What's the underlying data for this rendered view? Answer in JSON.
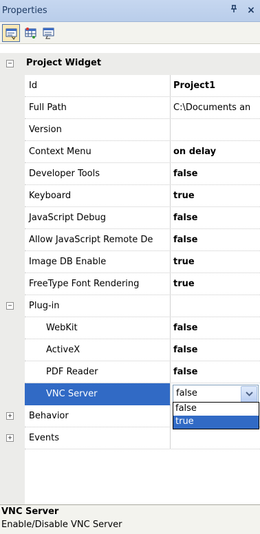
{
  "panel": {
    "title": "Properties",
    "pin_glyph": "ᵖ",
    "close_glyph": "×"
  },
  "toolbar": {
    "buttons": [
      {
        "name": "categorized-view",
        "active": true
      },
      {
        "name": "property-pages",
        "active": false
      },
      {
        "name": "alphabetical-view",
        "active": false
      }
    ]
  },
  "grid": {
    "category": {
      "name": "Project Widget",
      "expander": "−"
    },
    "properties": [
      {
        "name": "Id",
        "value": "Project1",
        "bold": true
      },
      {
        "name": "Full Path",
        "value": "C:\\Documents an",
        "bold": false
      },
      {
        "name": "Version",
        "value": "",
        "bold": false
      },
      {
        "name": "Context Menu",
        "value": "on delay",
        "bold": true
      },
      {
        "name": "Developer Tools",
        "value": "false",
        "bold": true
      },
      {
        "name": "Keyboard",
        "value": "true",
        "bold": true
      },
      {
        "name": "JavaScript Debug",
        "value": "false",
        "bold": true
      },
      {
        "name": "Allow JavaScript Remote De",
        "value": "false",
        "bold": true
      },
      {
        "name": "Image DB Enable",
        "value": "true",
        "bold": true
      },
      {
        "name": "FreeType Font Rendering",
        "value": "true",
        "bold": true
      }
    ],
    "plugin": {
      "name": "Plug-in",
      "expander": "−",
      "items": [
        {
          "name": "WebKit",
          "value": "false"
        },
        {
          "name": "ActiveX",
          "value": "false"
        },
        {
          "name": "PDF Reader",
          "value": "false"
        }
      ],
      "selected": {
        "name": "VNC Server",
        "value": "false"
      }
    },
    "behavior": {
      "name": "Behavior",
      "expander": "+"
    },
    "events": {
      "name": "Events",
      "expander": "+"
    }
  },
  "dropdown": {
    "options": [
      "false",
      "true"
    ],
    "highlighted": "true"
  },
  "description": {
    "title": "VNC Server",
    "text": "Enable/Disable VNC Server"
  }
}
